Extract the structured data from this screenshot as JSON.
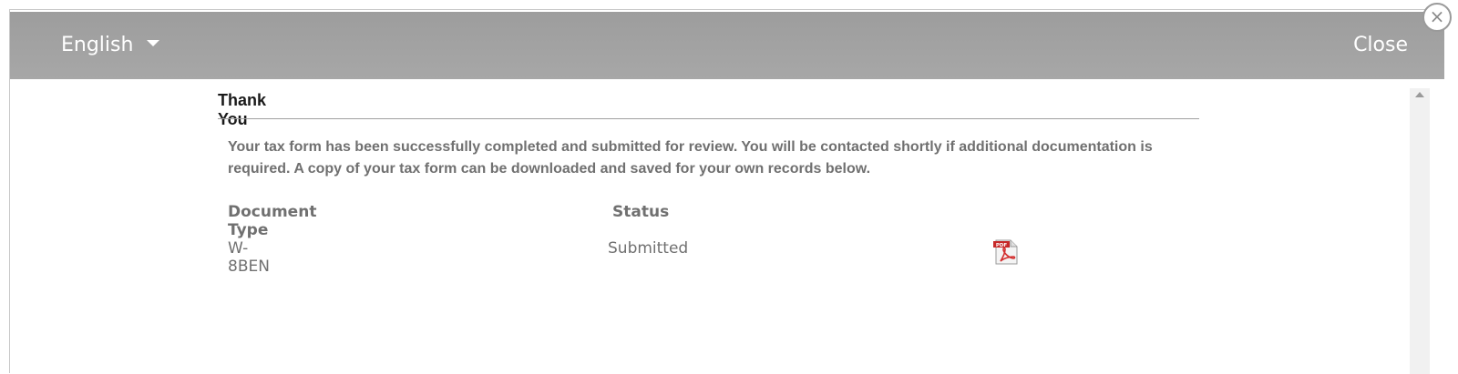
{
  "header": {
    "language_label": "English",
    "close_label": "Close",
    "close_x": "×"
  },
  "panel": {
    "title": "Thank You",
    "message": "Your tax form has been successfully completed and submitted for review. You will be contacted shortly if additional documentation is required. A copy of your tax form can be downloaded and saved for your own records below."
  },
  "table": {
    "columns": [
      "Document Type",
      "Status"
    ],
    "rows": [
      {
        "document_type": "W-8BEN",
        "status": "Submitted",
        "download_icon": "pdf-icon"
      }
    ]
  },
  "colors": {
    "header_bg": "#a3a3a3",
    "text_gray": "#707070",
    "pdf_red": "#d32f2f"
  }
}
